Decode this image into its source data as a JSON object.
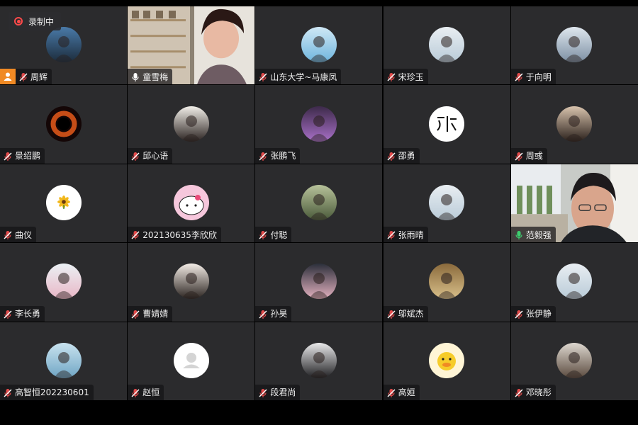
{
  "recording": {
    "label": "录制中"
  },
  "colors": {
    "tile_bg": "#2b2b2d",
    "active_border": "#3ccf6e",
    "host_badge": "#f08a24",
    "mic_muted": "#e14b4b",
    "mic_active": "#3ccf6e"
  },
  "participants": [
    {
      "name": "周辉",
      "mic": "muted",
      "host": true,
      "avatar": "landscape-photo-icon"
    },
    {
      "name": "童雪梅",
      "mic": "on",
      "video": true,
      "avatar": "camera-video-feed"
    },
    {
      "name": "山东大学~马康凤",
      "mic": "muted",
      "avatar": "illustration-icon"
    },
    {
      "name": "宋珍玉",
      "mic": "muted",
      "avatar": "girl-photo-icon"
    },
    {
      "name": "于向明",
      "mic": "muted",
      "avatar": "mountain-photo-icon"
    },
    {
      "name": "景绍鹏",
      "mic": "muted",
      "avatar": "black-hole-icon"
    },
    {
      "name": "邱心语",
      "mic": "muted",
      "avatar": "portrait-photo-icon"
    },
    {
      "name": "张鹏飞",
      "mic": "muted",
      "avatar": "anime-character-icon"
    },
    {
      "name": "邵勇",
      "mic": "muted",
      "avatar": "calligraphy-icon"
    },
    {
      "name": "周彧",
      "mic": "muted",
      "avatar": "girl-back-photo-icon"
    },
    {
      "name": "曲仪",
      "mic": "muted",
      "avatar": "sunflower-icon"
    },
    {
      "name": "202130635李欣欣",
      "mic": "muted",
      "avatar": "hello-kitty-icon"
    },
    {
      "name": "付聪",
      "mic": "muted",
      "avatar": "soldier-photo-icon"
    },
    {
      "name": "张雨晴",
      "mic": "muted",
      "avatar": "girl-photo-icon"
    },
    {
      "name": "范毅强",
      "mic": "on-active",
      "video": true,
      "active": true,
      "avatar": "camera-video-feed"
    },
    {
      "name": "李长勇",
      "mic": "muted",
      "avatar": "blossom-tree-icon"
    },
    {
      "name": "曹婧婧",
      "mic": "muted",
      "avatar": "illustrated-girl-icon"
    },
    {
      "name": "孙昊",
      "mic": "muted",
      "avatar": "flowers-photo-icon"
    },
    {
      "name": "邬斌杰",
      "mic": "muted",
      "avatar": "building-photo-icon"
    },
    {
      "name": "张伊静",
      "mic": "muted",
      "avatar": "girl-photo-icon"
    },
    {
      "name": "高智恒202230601",
      "mic": "muted",
      "avatar": "collage-photo-icon"
    },
    {
      "name": "赵恒",
      "mic": "muted",
      "avatar": "default-user-icon"
    },
    {
      "name": "段君尚",
      "mic": "muted",
      "avatar": "woman-photo-icon"
    },
    {
      "name": "高姮",
      "mic": "muted",
      "avatar": "yellow-duck-icon"
    },
    {
      "name": "邓晓彤",
      "mic": "muted",
      "avatar": "man-photo-icon"
    }
  ]
}
